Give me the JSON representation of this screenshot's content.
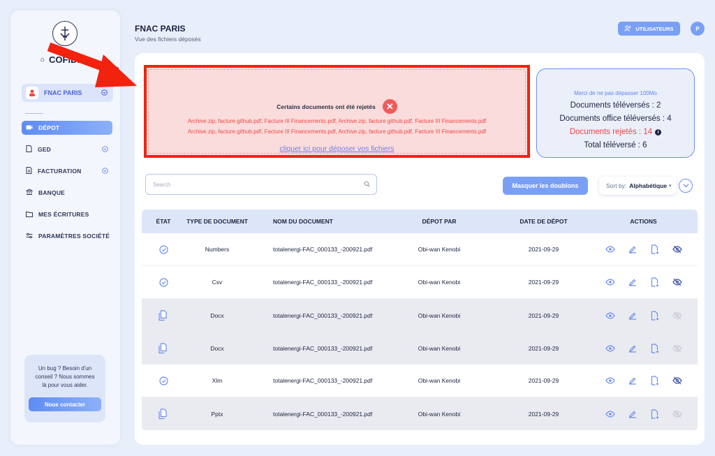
{
  "sidebar": {
    "brand": "COFIDEC",
    "company": "FNAC PARIS",
    "nav": [
      {
        "label": "DÉPOT",
        "active": true,
        "icon": "camera-icon"
      },
      {
        "label": "GED",
        "expandable": true,
        "icon": "document-icon"
      },
      {
        "label": "FACTURATION",
        "expandable": true,
        "icon": "invoice-icon"
      },
      {
        "label": "BANQUE",
        "icon": "bank-icon"
      },
      {
        "label": "MES ÉCRITURES",
        "icon": "folder-icon"
      },
      {
        "label": "PARAMÈTRES SOCIÉTÉ",
        "icon": "sliders-icon"
      }
    ],
    "help": {
      "text": "Un bug ? Besoin d'un conseil ? Nous sommes là pour vous aider.",
      "button": "Nous contacter"
    }
  },
  "header": {
    "title": "FNAC PARIS",
    "subtitle": "Vue des fichiers déposés",
    "users_button": "UTILISATEURS",
    "profile_initial": "P"
  },
  "upload": {
    "rejected_title": "Certains documents ont été rejetés",
    "rejected_files_line1": "Archive.zip, facture github.pdf, Facture III Financements.pdf, Archive.zip, facture github.pdf, Facture III Financements.pdf",
    "rejected_files_line2": "Archive.zip, facture github.pdf, Facture III Financements.pdf, Archive.zip, facture github.pdf, Facture III Financements.pdf",
    "link": "cliquer ici pour déposer vos fichiers"
  },
  "stats": {
    "warning": "Merci de ne pas dépasser 100Mo",
    "uploaded": "Documents téléversés : 2",
    "office": "Documents office téléversés : 4",
    "rejected": "Documents rejetés : 14",
    "total": "Total téléversé : 6"
  },
  "controls": {
    "search_placeholder": "Search",
    "hide_duplicates": "Masquer les doublons",
    "sort_label": "Sort by:",
    "sort_value": "Alphabétique"
  },
  "table": {
    "headers": [
      "ÉTAT",
      "TYPE DE DOCUMENT",
      "NOM DU DOCUMENT",
      "DÉPOT PAR",
      "DATE DE DÉPOT",
      "ACTIONS"
    ],
    "rows": [
      {
        "state": "check",
        "type": "Numbers",
        "name": "totalenergi-FAC_000133_-200921.pdf",
        "by": "Obi-wan Kenobi",
        "date": "2021-09-29",
        "hide_active": true
      },
      {
        "state": "check",
        "type": "Csv",
        "name": "totalenergi-FAC_000133_-200921.pdf",
        "by": "Obi-wan Kenobi",
        "date": "2021-09-29",
        "hide_active": true
      },
      {
        "state": "duplicate",
        "type": "Docx",
        "name": "totalenergi-FAC_000133_-200921.pdf",
        "by": "Obi-wan Kenobi",
        "date": "2021-09-29",
        "hide_active": false
      },
      {
        "state": "duplicate",
        "type": "Docx",
        "name": "totalenergi-FAC_000133_-200921.pdf",
        "by": "Obi-wan Kenobi",
        "date": "2021-09-29",
        "hide_active": false
      },
      {
        "state": "check",
        "type": "Xlm",
        "name": "totalenergi-FAC_000133_-200921.pdf",
        "by": "Obi-wan Kenobi",
        "date": "2021-09-29",
        "hide_active": true
      },
      {
        "state": "duplicate",
        "type": "Pptx",
        "name": "totalenergi-FAC_000133_-200921.pdf",
        "by": "Obi-wan Kenobi",
        "date": "2021-09-29",
        "hide_active": false
      }
    ]
  },
  "colors": {
    "accent": "#6c8ef0",
    "reject_red": "#ef4545",
    "annotation_red": "#f2220f"
  }
}
